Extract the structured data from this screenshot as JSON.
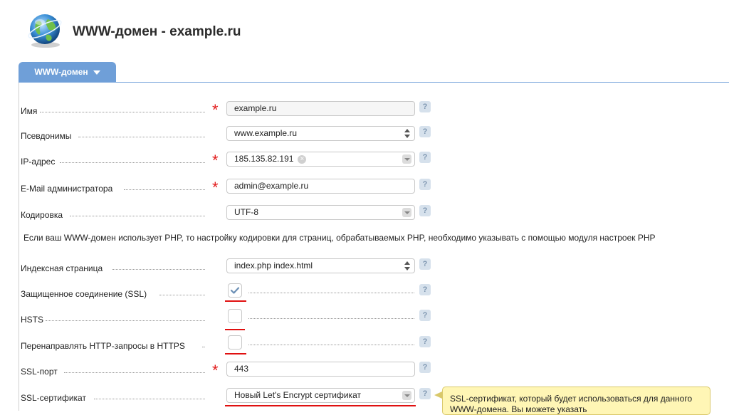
{
  "header": {
    "title": "WWW-домен - example.ru",
    "icon": "globe-icon"
  },
  "tabs": [
    {
      "label": "WWW-домен"
    }
  ],
  "form": {
    "name": {
      "label": "Имя",
      "value": "example.ru"
    },
    "aliases": {
      "label": "Псевдонимы",
      "value": "www.example.ru"
    },
    "ip": {
      "label": "IP-адрес",
      "value": "185.135.82.191"
    },
    "email": {
      "label": "E-Mail администратора",
      "value": "admin@example.ru"
    },
    "charset": {
      "label": "Кодировка",
      "value": "UTF-8"
    },
    "note": "Если ваш WWW-домен использует PHP, то настройку кодировки для страниц, обрабатываемых PHP, необходимо указывать с помощью модуля настроек PHP",
    "index": {
      "label": "Индексная страница",
      "value": "index.php index.html"
    },
    "ssl": {
      "label": "Защищенное соединение (SSL)",
      "checked": true
    },
    "hsts": {
      "label": "HSTS",
      "checked": false
    },
    "redirect": {
      "label": "Перенаправлять HTTP-запросы в HTTPS",
      "checked": false
    },
    "ssl_port": {
      "label": "SSL-порт",
      "value": "443"
    },
    "ssl_cert": {
      "label": "SSL-сертификат",
      "value": "Новый Let's Encrypt сертификат"
    },
    "required_mark": "*",
    "help_label": "?"
  },
  "tooltip": {
    "text": "SSL-сертификат, который будет использоваться для данного WWW-домена. Вы можете указать"
  },
  "colors": {
    "tab": "#6f9fd8",
    "required": "#e21b1b",
    "highlight": "#e01010",
    "tooltip_bg": "#fff6b5"
  }
}
